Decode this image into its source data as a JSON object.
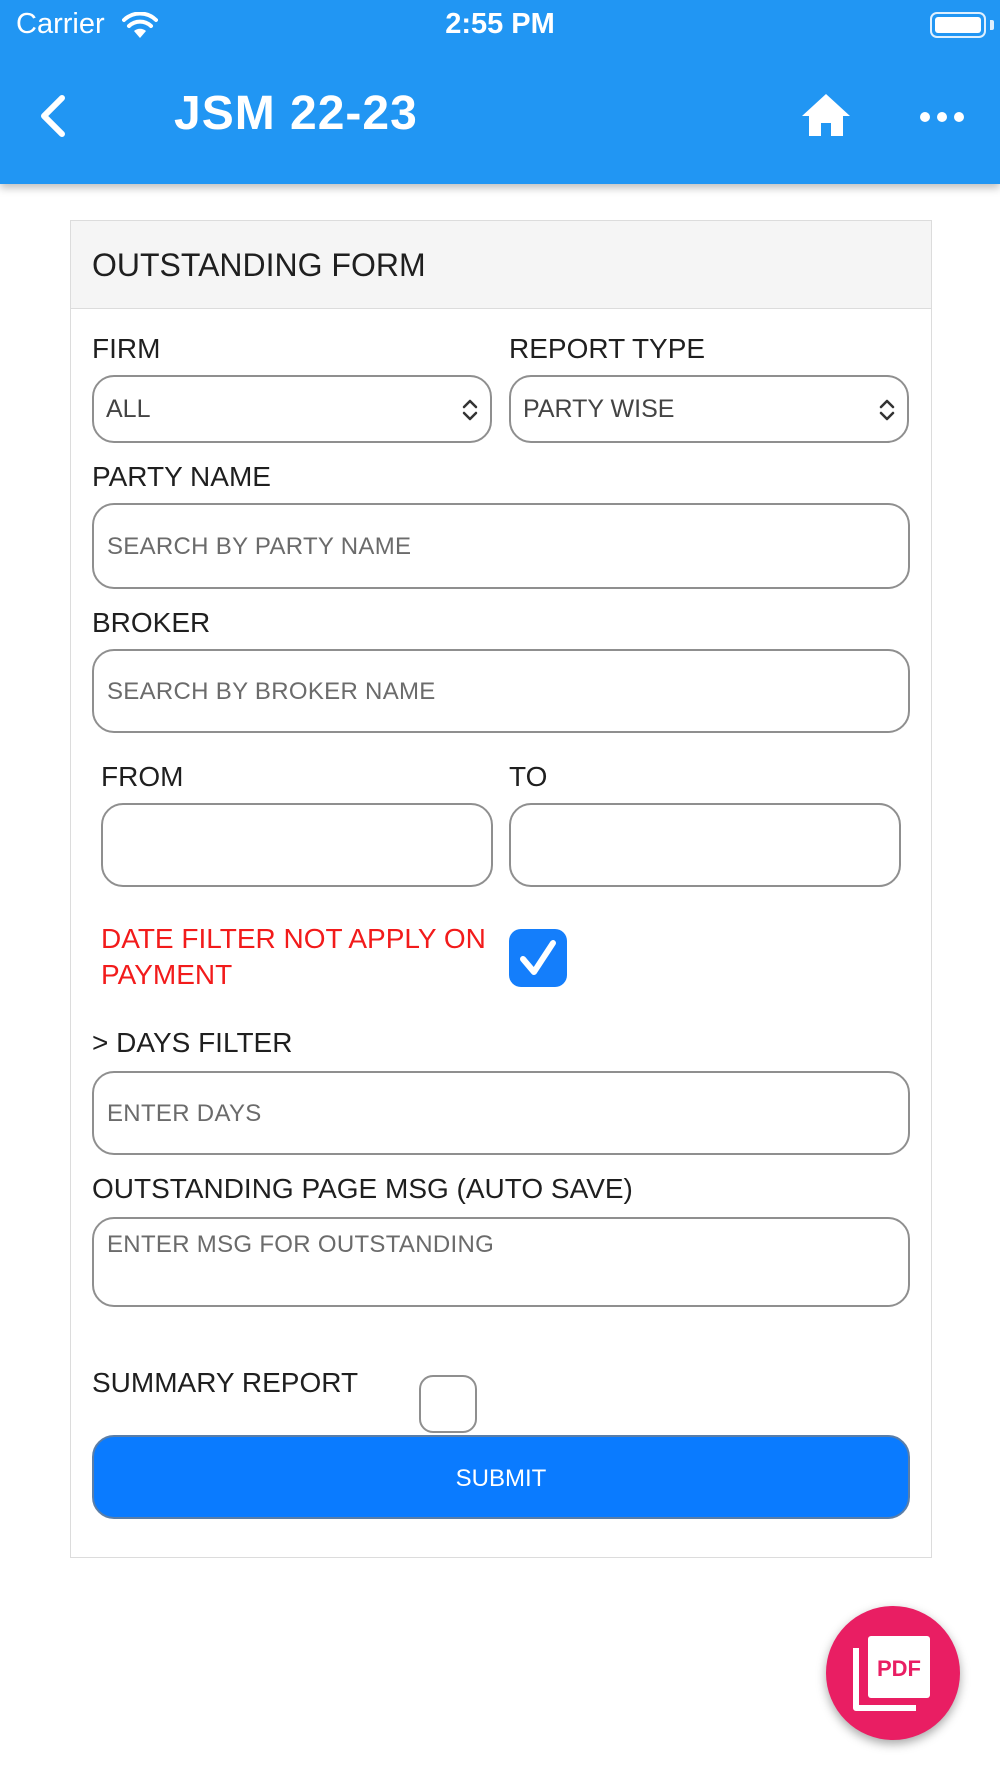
{
  "status_bar": {
    "carrier": "Carrier",
    "time": "2:55 PM"
  },
  "app_bar": {
    "title": "JSM 22-23",
    "icons": [
      "back-icon",
      "home-icon",
      "more-icon"
    ]
  },
  "form": {
    "title": "OUTSTANDING FORM",
    "firm": {
      "label": "FIRM",
      "value": "ALL"
    },
    "report_type": {
      "label": "REPORT TYPE",
      "value": "PARTY WISE"
    },
    "party_name": {
      "label": "PARTY NAME",
      "placeholder": "SEARCH BY PARTY NAME"
    },
    "broker": {
      "label": "BROKER",
      "placeholder": "SEARCH BY BROKER NAME"
    },
    "from": {
      "label": "FROM",
      "value": ""
    },
    "to": {
      "label": "TO",
      "value": ""
    },
    "date_filter": {
      "label": "DATE FILTER NOT APPLY ON PAYMENT",
      "checked": true
    },
    "days_filter": {
      "label": "> DAYS FILTER",
      "placeholder": "ENTER DAYS"
    },
    "page_msg": {
      "label": "OUTSTANDING PAGE MSG (AUTO SAVE)",
      "placeholder": "ENTER MSG FOR OUTSTANDING"
    },
    "summary_report": {
      "label": "SUMMARY REPORT",
      "checked": false
    },
    "submit_label": "SUBMIT"
  },
  "fab": {
    "icon": "pdf-icon",
    "text": "PDF"
  },
  "colors": {
    "app_bar": "#2196f3",
    "primary_button": "#0a7bff",
    "warning_text": "#f21b1b",
    "fab": "#e91e63"
  }
}
